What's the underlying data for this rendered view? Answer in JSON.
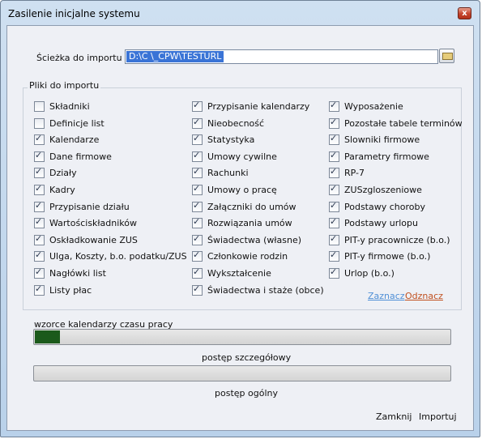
{
  "window": {
    "title": "Zasilenie inicjalne systemu",
    "close_glyph": "x"
  },
  "path": {
    "label": "Ścieżka do importu :",
    "value": "D:\\C          \\_CPW\\TESTURL"
  },
  "group": {
    "title": "Pliki do importu"
  },
  "checkboxes": {
    "col1": [
      {
        "label": "Składniki",
        "checked": false
      },
      {
        "label": "Definicje list",
        "checked": false
      },
      {
        "label": "Kalendarze",
        "checked": true
      },
      {
        "label": "Dane firmowe",
        "checked": true
      },
      {
        "label": "Działy",
        "checked": true
      },
      {
        "label": "Kadry",
        "checked": true
      },
      {
        "label": "Przypisanie działu",
        "checked": true
      },
      {
        "label": "Wartościskładników",
        "checked": true
      },
      {
        "label": "Oskładkowanie ZUS",
        "checked": true
      },
      {
        "label": "Ulga, Koszty, b.o. podatku/ZUS",
        "checked": true
      },
      {
        "label": "Nagłówki list",
        "checked": true
      },
      {
        "label": "Listy płac",
        "checked": true
      }
    ],
    "col2": [
      {
        "label": "Przypisanie kalendarzy",
        "checked": true
      },
      {
        "label": "Nieobecność",
        "checked": true
      },
      {
        "label": "Statystyka",
        "checked": true
      },
      {
        "label": "Umowy cywilne",
        "checked": true
      },
      {
        "label": "Rachunki",
        "checked": true
      },
      {
        "label": "Umowy o pracę",
        "checked": true
      },
      {
        "label": "Załączniki do umów",
        "checked": true
      },
      {
        "label": "Rozwiązania umów",
        "checked": true
      },
      {
        "label": "Świadectwa (własne)",
        "checked": true
      },
      {
        "label": "Członkowie rodzin",
        "checked": true
      },
      {
        "label": "Wykształcenie",
        "checked": true
      },
      {
        "label": "Świadectwa i staże (obce)",
        "checked": true
      }
    ],
    "col3": [
      {
        "label": "Wyposażenie",
        "checked": true
      },
      {
        "label": "Pozostałe tabele terminów",
        "checked": true
      },
      {
        "label": "Slowniki firmowe",
        "checked": true
      },
      {
        "label": "Parametry firmowe",
        "checked": true
      },
      {
        "label": "RP-7",
        "checked": true
      },
      {
        "label": "ZUSzgloszeniowe",
        "checked": true
      },
      {
        "label": "Podstawy choroby",
        "checked": true
      },
      {
        "label": "Podstawy urlopu",
        "checked": true
      },
      {
        "label": "PIT-y pracownicze (b.o.)",
        "checked": true
      },
      {
        "label": "PIT-y firmowe (b.o.)",
        "checked": true
      },
      {
        "label": "Urlop (b.o.)",
        "checked": true
      }
    ]
  },
  "links": {
    "select_all": "Zaznacz",
    "deselect_all": "Odznacz"
  },
  "progress": {
    "detail_caption": "wzorce kalendarzy czasu pracy",
    "detail_label": "postęp szczegółowy",
    "detail_value": 0.06,
    "overall_label": "postęp ogólny",
    "overall_value": 0
  },
  "buttons": {
    "close": "Zamknij",
    "import": "Importuj"
  },
  "colors": {
    "select_link": "#4f8fd6",
    "deselect_link": "#c0501f",
    "progress_fill": "#1b5a1b",
    "selection": "#3a74d6"
  }
}
